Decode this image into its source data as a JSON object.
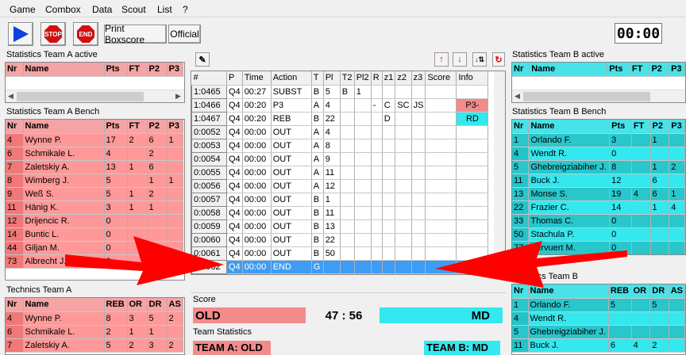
{
  "menu": [
    "Game",
    "Combox",
    "Data",
    "Scout",
    "List",
    "?"
  ],
  "toolbar": {
    "play_label": "",
    "stop_label": "STOP",
    "end_label": "END",
    "print_boxscore_label": "Print Boxscore",
    "official_label": "Official"
  },
  "clock": "00:00",
  "colors": {
    "team_a": "#ff9999",
    "team_b": "#33e8ee",
    "selected_row": "#3d9cf5",
    "arrow": "#ff0000"
  },
  "stats_a_active": {
    "title": "Statistics Team A active",
    "columns": [
      "Nr",
      "Name",
      "Pts",
      "FT",
      "P2",
      "P3"
    ],
    "rows": []
  },
  "stats_a_bench": {
    "title": "Statistics Team A Bench",
    "columns": [
      "Nr",
      "Name",
      "Pts",
      "FT",
      "P2",
      "P3"
    ],
    "rows": [
      [
        "4",
        "Wynne P.",
        "17",
        "2",
        "6",
        "1"
      ],
      [
        "6",
        "Schmikale L.",
        "4",
        "",
        "2",
        ""
      ],
      [
        "7",
        "Zaletskiy A.",
        "13",
        "1",
        "6",
        ""
      ],
      [
        "8",
        "Wimberg J.",
        "5",
        "",
        "1",
        "1"
      ],
      [
        "9",
        "Weß S.",
        "5",
        "1",
        "2",
        ""
      ],
      [
        "11",
        "Hänig K.",
        "3",
        "1",
        "1",
        ""
      ],
      [
        "12",
        "Drijencic R.",
        "0",
        "",
        "",
        ""
      ],
      [
        "14",
        "Buntic L.",
        "0",
        "",
        "",
        ""
      ],
      [
        "44",
        "Giljan M.",
        "0",
        "",
        "",
        ""
      ],
      [
        "73",
        "Albrecht J.",
        "0",
        "",
        "",
        ""
      ]
    ]
  },
  "technics_a": {
    "title": "Technics Team A",
    "columns": [
      "Nr",
      "Name",
      "REB",
      "OR",
      "DR",
      "AS"
    ],
    "rows": [
      [
        "4",
        "Wynne P.",
        "8",
        "3",
        "5",
        "2"
      ],
      [
        "6",
        "Schmikale L.",
        "2",
        "1",
        "1",
        ""
      ],
      [
        "7",
        "Zaletskiy A.",
        "5",
        "2",
        "3",
        "2"
      ]
    ]
  },
  "actions": {
    "columns": [
      "#",
      "P",
      "Time",
      "Action",
      "T",
      "Pl",
      "T2",
      "Pl2",
      "R",
      "z1",
      "z2",
      "z3",
      "Score",
      "Info"
    ],
    "rows": [
      [
        "1:0465",
        "Q4",
        "00:27",
        "SUBST",
        "B",
        "5",
        "B",
        "1",
        "",
        "",
        "",
        "",
        "",
        ""
      ],
      [
        "1:0466",
        "Q4",
        "00:20",
        "P3",
        "A",
        "4",
        "",
        "",
        "-",
        "C",
        "SC",
        "JS",
        "",
        "P3-"
      ],
      [
        "1:0467",
        "Q4",
        "00:20",
        "REB",
        "B",
        "22",
        "",
        "",
        "",
        "D",
        "",
        "",
        "",
        "RD"
      ],
      [
        "0:0052",
        "Q4",
        "00:00",
        "OUT",
        "A",
        "4",
        "",
        "",
        "",
        "",
        "",
        "",
        "",
        ""
      ],
      [
        "0:0053",
        "Q4",
        "00:00",
        "OUT",
        "A",
        "8",
        "",
        "",
        "",
        "",
        "",
        "",
        "",
        ""
      ],
      [
        "0:0054",
        "Q4",
        "00:00",
        "OUT",
        "A",
        "9",
        "",
        "",
        "",
        "",
        "",
        "",
        "",
        ""
      ],
      [
        "0:0055",
        "Q4",
        "00:00",
        "OUT",
        "A",
        "11",
        "",
        "",
        "",
        "",
        "",
        "",
        "",
        ""
      ],
      [
        "0:0056",
        "Q4",
        "00:00",
        "OUT",
        "A",
        "12",
        "",
        "",
        "",
        "",
        "",
        "",
        "",
        ""
      ],
      [
        "0:0057",
        "Q4",
        "00:00",
        "OUT",
        "B",
        "1",
        "",
        "",
        "",
        "",
        "",
        "",
        "",
        ""
      ],
      [
        "0:0058",
        "Q4",
        "00:00",
        "OUT",
        "B",
        "11",
        "",
        "",
        "",
        "",
        "",
        "",
        "",
        ""
      ],
      [
        "0:0059",
        "Q4",
        "00:00",
        "OUT",
        "B",
        "13",
        "",
        "",
        "",
        "",
        "",
        "",
        "",
        ""
      ],
      [
        "0:0060",
        "Q4",
        "00:00",
        "OUT",
        "B",
        "22",
        "",
        "",
        "",
        "",
        "",
        "",
        "",
        ""
      ],
      [
        "0:0061",
        "Q4",
        "00:00",
        "OUT",
        "B",
        "50",
        "",
        "",
        "",
        "",
        "",
        "",
        "",
        ""
      ],
      [
        "0:0062",
        "Q4",
        "00:00",
        "END",
        "G",
        "",
        "",
        "",
        "",
        "",
        "",
        "",
        "",
        ""
      ]
    ],
    "selected_index": 13
  },
  "score": {
    "label": "Score",
    "team_a": "OLD",
    "team_b": "MD",
    "value": "47 :  56"
  },
  "team_statistics": {
    "label": "Team Statistics",
    "team_a_label": "TEAM A: OLD",
    "team_b_label": "TEAM B: MD"
  },
  "stats_b_active": {
    "title": "Statistics Team B active",
    "columns": [
      "Nr",
      "Name",
      "Pts",
      "FT",
      "P2",
      "P3"
    ],
    "rows": []
  },
  "stats_b_bench": {
    "title": "Statistics Team B Bench",
    "columns": [
      "Nr",
      "Name",
      "Pts",
      "FT",
      "P2",
      "P3"
    ],
    "rows": [
      [
        "1",
        "Orlando F.",
        "3",
        "",
        "1",
        ""
      ],
      [
        "4",
        "Wendt R.",
        "0",
        "",
        "",
        ""
      ],
      [
        "5",
        "Ghebreigziabiher J.",
        "8",
        "",
        "1",
        "2"
      ],
      [
        "11",
        "Buck J.",
        "12",
        "",
        "6",
        ""
      ],
      [
        "13",
        "Monse S.",
        "19",
        "4",
        "6",
        "1"
      ],
      [
        "22",
        "Frazier C.",
        "14",
        "",
        "1",
        "4"
      ],
      [
        "33",
        "Thomas C.",
        "0",
        "",
        "",
        ""
      ],
      [
        "50",
        "Stachula P.",
        "0",
        "",
        "",
        ""
      ],
      [
        "77",
        "Vervuert M.",
        "0",
        "",
        "",
        ""
      ]
    ]
  },
  "technics_b": {
    "title": "Technics Team B",
    "columns": [
      "Nr",
      "Name",
      "REB",
      "OR",
      "DR",
      "AS"
    ],
    "rows": [
      [
        "1",
        "Orlando F.",
        "5",
        "",
        "5",
        ""
      ],
      [
        "4",
        "Wendt R.",
        "",
        "",
        "",
        ""
      ],
      [
        "5",
        "Ghebreigziabiher J.",
        "",
        "",
        "",
        ""
      ],
      [
        "11",
        "Buck J.",
        "6",
        "4",
        "2",
        ""
      ]
    ]
  }
}
